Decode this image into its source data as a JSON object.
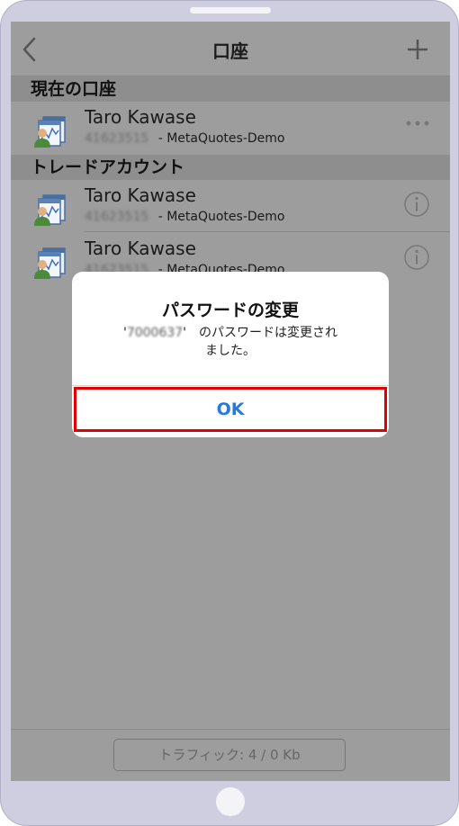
{
  "nav": {
    "title": "口座"
  },
  "sections": {
    "current": "現在の口座",
    "trade": "トレードアカウント"
  },
  "accounts": [
    {
      "name": "Taro Kawase",
      "number": "41623515",
      "server": " - MetaQuotes-Demo"
    },
    {
      "name": "Taro Kawase",
      "number": "41623515",
      "server": " - MetaQuotes-Demo"
    },
    {
      "name": "Taro Kawase",
      "number": "41623515",
      "server": " - MetaQuotes-Demo"
    }
  ],
  "dialog": {
    "title": "パスワードの変更",
    "quote_open": "'",
    "account_number": "7000637",
    "quote_close": "'",
    "message_line1": "　のパスワードは変更され",
    "message_line2": "ました。",
    "ok_label": "OK"
  },
  "footer": {
    "traffic_label": "トラフィック: 4 / 0 Kb"
  },
  "colors": {
    "overlay": "#9d9d9d",
    "accent": "#2878e0",
    "highlight": "#e00000"
  },
  "icons": {
    "back": "chevron-left",
    "add": "plus",
    "account": "account-avatar",
    "more": "ellipsis",
    "info": "info-circle"
  }
}
